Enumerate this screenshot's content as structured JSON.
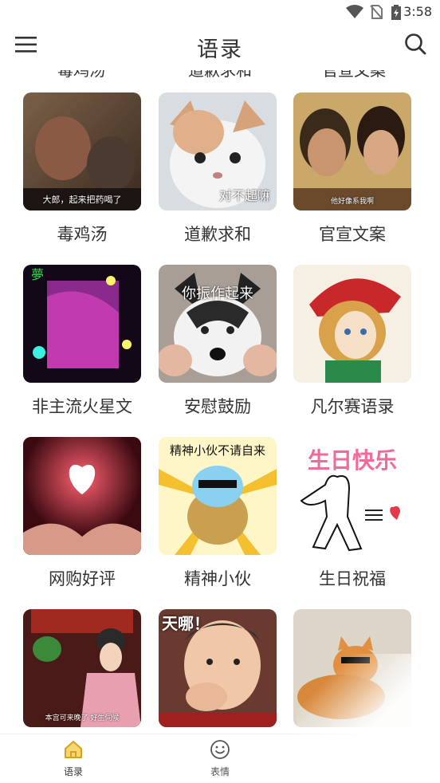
{
  "status_bar": {
    "time": "3:58"
  },
  "app_bar": {
    "title": "语录"
  },
  "partial_row_labels": [
    "毒鸡汤",
    "道歉求和",
    "官宣文案"
  ],
  "items": [
    {
      "label": "毒鸡汤",
      "caption": "大郎，起来把药喝了"
    },
    {
      "label": "道歉求和",
      "caption": "对不起嘛"
    },
    {
      "label": "官宣文案",
      "caption": "他好像系我啊"
    },
    {
      "label": "非主流火星文",
      "caption": ""
    },
    {
      "label": "安慰鼓励",
      "caption": "你振作起来"
    },
    {
      "label": "凡尔赛语录",
      "caption": ""
    },
    {
      "label": "网购好评",
      "caption": ""
    },
    {
      "label": "精神小伙",
      "caption": "精神小伙不请自来"
    },
    {
      "label": "生日祝福",
      "caption": "生日快乐"
    },
    {
      "label": "",
      "caption": "本宫可来晚了  好生伺候"
    },
    {
      "label": "",
      "caption": "天哪！"
    },
    {
      "label": "",
      "caption": ""
    }
  ],
  "bottom_nav": {
    "tabs": [
      {
        "label": "语录",
        "icon": "home-icon",
        "active": true
      },
      {
        "label": "表情",
        "icon": "smiley-icon",
        "active": false
      }
    ],
    "active_color": "#d9a21b"
  }
}
